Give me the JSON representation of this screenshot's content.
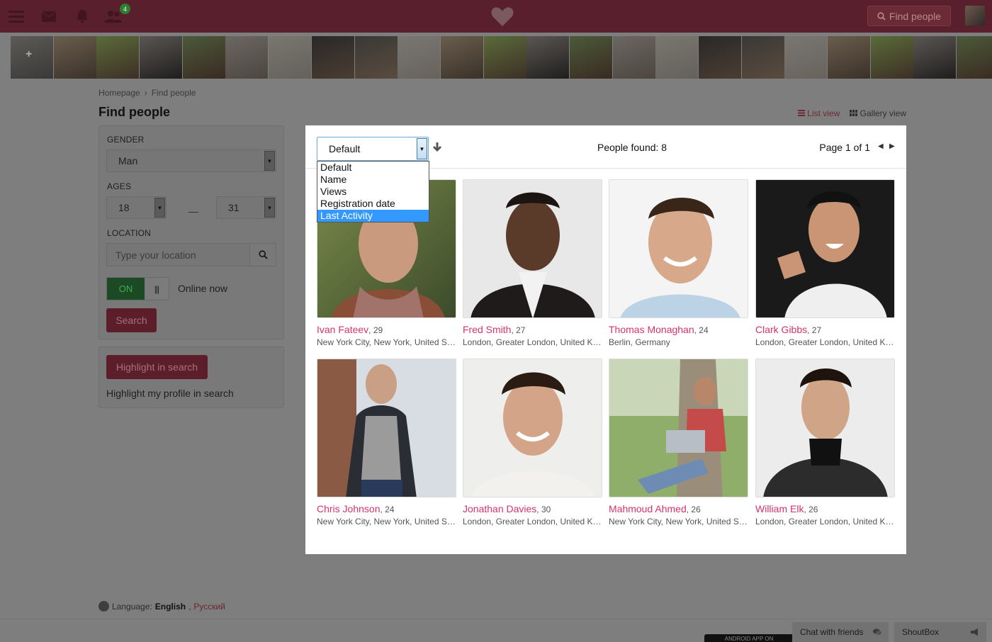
{
  "topbar": {
    "badge_count": "4",
    "find_label": "Find people"
  },
  "breadcrumb": {
    "home": "Homepage",
    "sep": "›",
    "current": "Find people"
  },
  "page_title": "Find people",
  "views": {
    "list": "List view",
    "gallery": "Gallery view"
  },
  "filter": {
    "gender_label": "GENDER",
    "gender_value": "Man",
    "ages_label": "AGES",
    "age_from": "18",
    "age_sep": "—",
    "age_to": "31",
    "location_label": "LOCATION",
    "location_placeholder": "Type your location",
    "toggle_on": "ON",
    "toggle_grip": "|||",
    "online_label": "Online now",
    "search_label": "Search"
  },
  "highlight": {
    "button": "Highlight in search",
    "text": "Highlight my profile in search"
  },
  "results": {
    "sort_value": "Default",
    "sort_options": [
      "Default",
      "Name",
      "Views",
      "Registration date",
      "Last Activity"
    ],
    "people_found": "People found: 8",
    "page": "Page 1 of 1",
    "people": [
      {
        "name": "Ivan Fateev",
        "age": ", 29",
        "location": "New York City, New York, United States"
      },
      {
        "name": "Fred Smith",
        "age": ", 27",
        "location": "London, Greater London, United Kingdom"
      },
      {
        "name": "Thomas Monaghan",
        "age": ", 24",
        "location": "Berlin, Germany"
      },
      {
        "name": "Clark Gibbs",
        "age": ", 27",
        "location": "London, Greater London, United Kingdom"
      },
      {
        "name": "Chris Johnson",
        "age": ", 24",
        "location": "New York City, New York, United States"
      },
      {
        "name": "Jonathan Davies",
        "age": ", 30",
        "location": "London, Greater London, United Kingdom"
      },
      {
        "name": "Mahmoud Ahmed",
        "age": ", 26",
        "location": "New York City, New York, United States"
      },
      {
        "name": "William Elk",
        "age": ", 26",
        "location": "London, Greater London, United Kingdom"
      }
    ]
  },
  "footer": {
    "language_label": "Language:",
    "lang_en": "English",
    "lang_comma": ",",
    "lang_ru": "Русский",
    "app_badge": "ANDROID APP ON",
    "chat_tab": "Chat with friends",
    "shoutbox_tab": "ShoutBox"
  },
  "colors": {
    "brand": "#d8336a",
    "topbar": "#5a1f2c",
    "overlay": "#7e7e7e",
    "dropdown_selected": "#3399ff"
  }
}
